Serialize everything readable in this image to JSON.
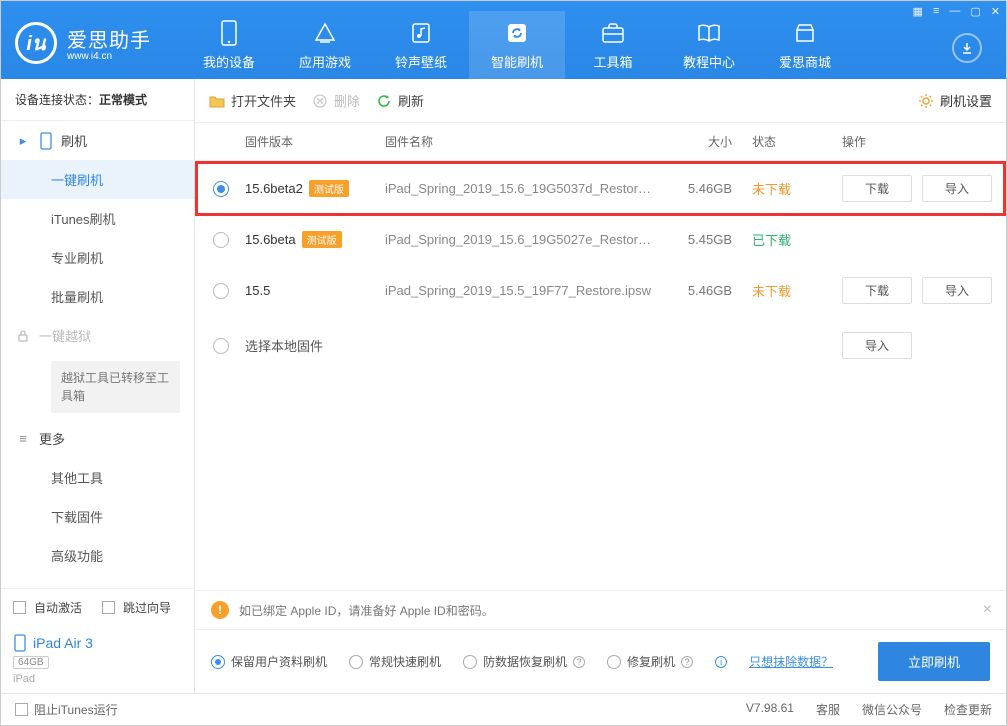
{
  "header": {
    "logo_text": "爱思助手",
    "logo_sub": "www.i4.cn",
    "nav": [
      {
        "label": "我的设备"
      },
      {
        "label": "应用游戏"
      },
      {
        "label": "铃声壁纸"
      },
      {
        "label": "智能刷机"
      },
      {
        "label": "工具箱"
      },
      {
        "label": "教程中心"
      },
      {
        "label": "爱思商城"
      }
    ]
  },
  "sidebar": {
    "status_label": "设备连接状态：",
    "status_value": "正常模式",
    "groups": {
      "flash": {
        "title": "刷机",
        "items": [
          "一键刷机",
          "iTunes刷机",
          "专业刷机",
          "批量刷机"
        ]
      },
      "jailbreak": {
        "title": "一键越狱",
        "note": "越狱工具已转移至工具箱"
      },
      "more": {
        "title": "更多",
        "items": [
          "其他工具",
          "下载固件",
          "高级功能"
        ]
      }
    },
    "auto_activate": "自动激活",
    "skip_guide": "跳过向导",
    "device": {
      "name": "iPad Air 3",
      "capacity": "64GB",
      "type": "iPad"
    }
  },
  "toolbar": {
    "open_folder": "打开文件夹",
    "delete": "删除",
    "refresh": "刷新",
    "settings": "刷机设置"
  },
  "grid_head": {
    "ver": "固件版本",
    "name": "固件名称",
    "size": "大小",
    "stat": "状态",
    "ops": "操作"
  },
  "rows": [
    {
      "selected": true,
      "version": "15.6beta2",
      "beta": "测试版",
      "name": "iPad_Spring_2019_15.6_19G5037d_Restore.i...",
      "size": "5.46GB",
      "status": "未下载",
      "st_cls": "st-no",
      "show_ops": true,
      "highlight": true
    },
    {
      "selected": false,
      "version": "15.6beta",
      "beta": "测试版",
      "name": "iPad_Spring_2019_15.6_19G5027e_Restore.ip...",
      "size": "5.45GB",
      "status": "已下载",
      "st_cls": "st-yes",
      "show_ops": false
    },
    {
      "selected": false,
      "version": "15.5",
      "beta": "",
      "name": "iPad_Spring_2019_15.5_19F77_Restore.ipsw",
      "size": "5.46GB",
      "status": "未下载",
      "st_cls": "st-no",
      "show_ops": true
    }
  ],
  "local_row": "选择本地固件",
  "buttons": {
    "download": "下载",
    "import": "导入"
  },
  "info_bar": "如已绑定 Apple ID，请准备好 Apple ID和密码。",
  "options": {
    "opt1": "保留用户资料刷机",
    "opt2": "常规快速刷机",
    "opt3": "防数据恢复刷机",
    "opt4": "修复刷机",
    "erase_link": "只想抹除数据？",
    "flash_now": "立即刷机"
  },
  "footer": {
    "block_itunes": "阻止iTunes运行",
    "version": "V7.98.61",
    "links": [
      "客服",
      "微信公众号",
      "检查更新"
    ]
  }
}
